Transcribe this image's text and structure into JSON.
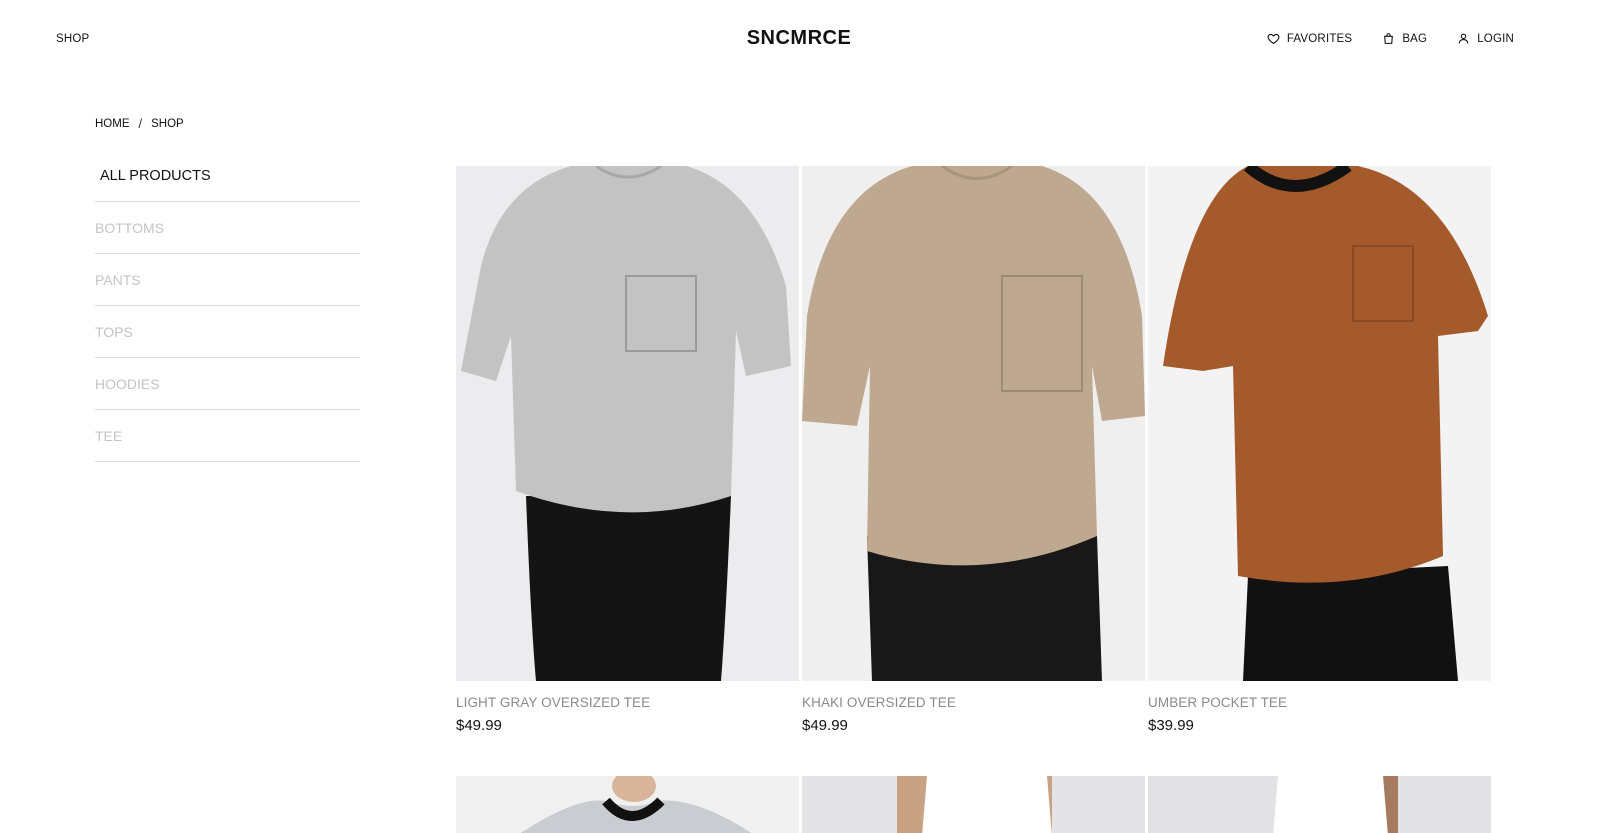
{
  "header": {
    "shop_link": "SHOP",
    "logo": "SNCMRCE",
    "favorites": "FAVORITES",
    "bag": "BAG",
    "login": "LOGIN"
  },
  "breadcrumb": {
    "home": "HOME",
    "separator": "/",
    "current": "SHOP"
  },
  "sidebar": {
    "categories": [
      {
        "label": "ALL PRODUCTS",
        "active": true
      },
      {
        "label": "BOTTOMS",
        "active": false
      },
      {
        "label": "PANTS",
        "active": false
      },
      {
        "label": "TOPS",
        "active": false
      },
      {
        "label": "HOODIES",
        "active": false
      },
      {
        "label": "TEE",
        "active": false
      }
    ]
  },
  "products": [
    {
      "name": "LIGHT GRAY OVERSIZED TEE",
      "price": "$49.99",
      "shirt_color": "#c2c3c2",
      "bg_color": "#ececee",
      "shorts_color": "#141414"
    },
    {
      "name": "KHAKI OVERSIZED TEE",
      "price": "$49.99",
      "shirt_color": "#bfa890",
      "bg_color": "#efefef",
      "shorts_color": "#181818"
    },
    {
      "name": "UMBER POCKET TEE",
      "price": "$39.99",
      "shirt_color": "#a55a2c",
      "bg_color": "#f3f3f3",
      "shorts_color": "#111111"
    }
  ],
  "products_row2": [
    {
      "shirt_color": "#c9ccd0",
      "bg_color": "#f0f0f0"
    },
    {
      "shirt_color": "#ffffff",
      "bg_color": "#e4e4e6"
    },
    {
      "shirt_color": "#ffffff",
      "bg_color": "#e2e2e4"
    }
  ],
  "colors": {
    "text": "#111111",
    "muted": "#8a8a8a",
    "inactive_category": "#c4c4c4",
    "divider": "#dcdcdc"
  }
}
